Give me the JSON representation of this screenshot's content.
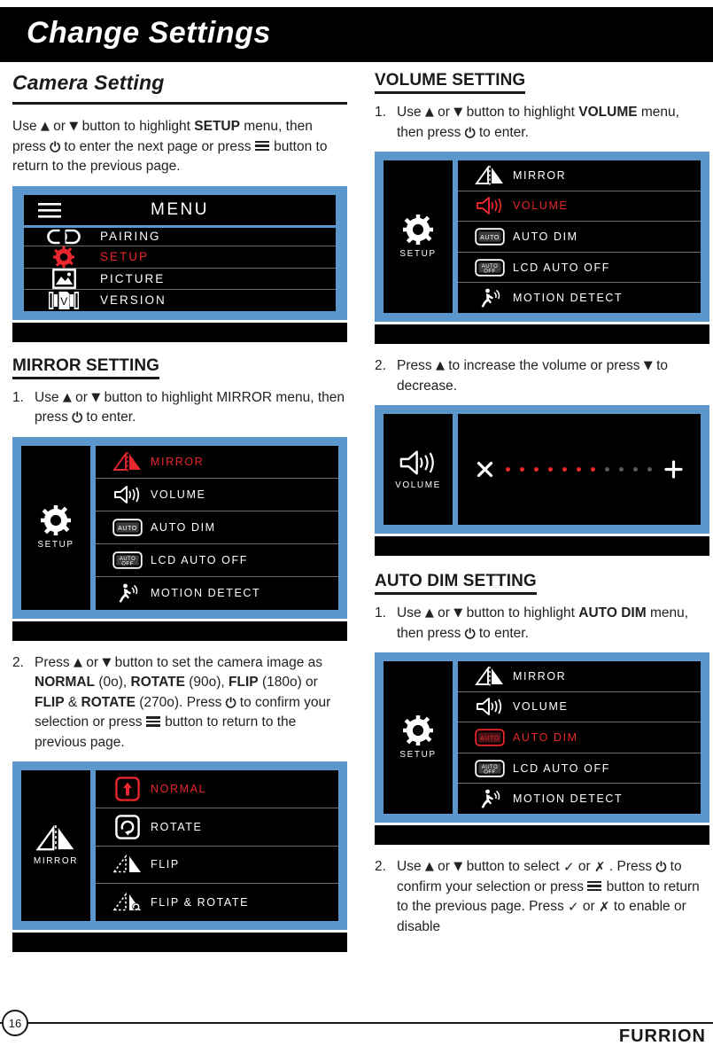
{
  "header": {
    "title": "Change Settings"
  },
  "colors": {
    "blue_frame": "#5B96CC",
    "accent_red": "#E8262D",
    "black": "#000000",
    "white": "#FFFFFF"
  },
  "footer": {
    "page_number": "16",
    "brand": "FURRION"
  },
  "left_column": {
    "section_title": "Camera Setting",
    "intro_text_1": "Use ",
    "intro_or": " or ",
    "intro_text_2": " button to highlight ",
    "intro_bold": "SETUP",
    "intro_text_3": " menu, then press ",
    "intro_text_4": " to enter the next page or press ",
    "intro_text_5": " button to return to the previous page.",
    "menu_shot": {
      "titlebar_label": "MENU",
      "items": [
        {
          "label": "PAIRING",
          "icon": "link-icon",
          "active": false
        },
        {
          "label": "SETUP",
          "icon": "gear-icon",
          "active": true
        },
        {
          "label": "PICTURE",
          "icon": "picture-icon",
          "active": false
        },
        {
          "label": "VERSION",
          "icon": "version-icon",
          "active": false
        }
      ]
    },
    "mirror": {
      "heading": "MIRROR SETTING",
      "step1_num": "1.",
      "step1_a": "Use ",
      "step1_or": " or ",
      "step1_b": " button to highlight MIRROR menu, then press ",
      "step1_c": " to enter.",
      "setup_shot": {
        "side_label": "SETUP",
        "side_icon": "gear-icon",
        "items": [
          {
            "label": "MIRROR",
            "icon": "mirror-icon",
            "active": true
          },
          {
            "label": "VOLUME",
            "icon": "speaker-icon",
            "active": false
          },
          {
            "label": "AUTO DIM",
            "icon": "auto-dim-icon",
            "active": false
          },
          {
            "label": "LCD AUTO OFF",
            "icon": "auto-off-icon",
            "active": false
          },
          {
            "label": "MOTION DETECT",
            "icon": "motion-detect-icon",
            "active": false
          }
        ]
      },
      "step2_num": "2.",
      "step2_a": "Press ",
      "step2_or": " or ",
      "step2_b": " button to set the camera image as ",
      "step2_opt1": "NORMAL",
      "step2_deg1": " (0o), ",
      "step2_opt2": "ROTATE",
      "step2_deg2": " (90o), ",
      "step2_opt3": "FLIP",
      "step2_deg3": " (180o) or ",
      "step2_opt4": "FLIP",
      "step2_amp": " & ",
      "step2_opt5": "ROTATE",
      "step2_deg4": " (270o). Press ",
      "step2_c": " to confirm your selection or press ",
      "step2_d": " button to return to the previous page.",
      "options_shot": {
        "side_label": "MIRROR",
        "side_icon": "mirror-icon",
        "items": [
          {
            "label": "NORMAL",
            "icon": "normal-arrow-icon",
            "active": true
          },
          {
            "label": "ROTATE",
            "icon": "rotate-icon",
            "active": false
          },
          {
            "label": "FLIP",
            "icon": "flip-icon",
            "active": false
          },
          {
            "label": "FLIP & ROTATE",
            "icon": "flip-rotate-icon",
            "active": false
          }
        ]
      }
    }
  },
  "right_column": {
    "volume": {
      "heading": "VOLUME SETTING",
      "step1_num": "1.",
      "step1_a": "Use ",
      "step1_or": " or ",
      "step1_b": " button to highlight ",
      "step1_bold": "VOLUME",
      "step1_c": " menu, then press ",
      "step1_d": " to enter.",
      "setup_shot": {
        "side_label": "SETUP",
        "side_icon": "gear-icon",
        "items": [
          {
            "label": "MIRROR",
            "icon": "mirror-icon",
            "active": false
          },
          {
            "label": "VOLUME",
            "icon": "speaker-icon",
            "active": true
          },
          {
            "label": "AUTO DIM",
            "icon": "auto-dim-icon",
            "active": false
          },
          {
            "label": "LCD AUTO OFF",
            "icon": "auto-off-icon",
            "active": false
          },
          {
            "label": "MOTION DETECT",
            "icon": "motion-detect-icon",
            "active": false
          }
        ]
      },
      "step2_num": "2.",
      "step2_a": "Press ",
      "step2_b": " to increase the volume or press ",
      "step2_c": " to decrease.",
      "slider_shot": {
        "side_label": "VOLUME",
        "side_icon": "speaker-icon",
        "minus_icon": "x-icon",
        "plus_icon": "plus-icon",
        "dots_total": 11,
        "dots_filled": 7
      }
    },
    "auto_dim": {
      "heading": "AUTO DIM SETTING",
      "step1_num": "1.",
      "step1_a": "Use ",
      "step1_or": " or ",
      "step1_b": " button to highlight ",
      "step1_bold": "AUTO DIM",
      "step1_c": " menu, then press ",
      "step1_d": " to enter.",
      "setup_shot": {
        "side_label": "SETUP",
        "side_icon": "gear-icon",
        "items": [
          {
            "label": "MIRROR",
            "icon": "mirror-icon",
            "active": false
          },
          {
            "label": "VOLUME",
            "icon": "speaker-icon",
            "active": false
          },
          {
            "label": "AUTO DIM",
            "icon": "auto-dim-icon",
            "active": true
          },
          {
            "label": "LCD AUTO OFF",
            "icon": "auto-off-icon",
            "active": false
          },
          {
            "label": "MOTION DETECT",
            "icon": "motion-detect-icon",
            "active": false
          }
        ]
      },
      "step2_num": "2.",
      "step2_a": "Use ",
      "step2_or": " or ",
      "step2_b": " button to select ",
      "step2_c": " or ",
      "step2_d": " . Press ",
      "step2_e": " to confirm your selection or press ",
      "step2_f": " button to return to the previous page. Press ",
      "step2_g": " or ",
      "step2_h": " to enable or disable"
    }
  }
}
